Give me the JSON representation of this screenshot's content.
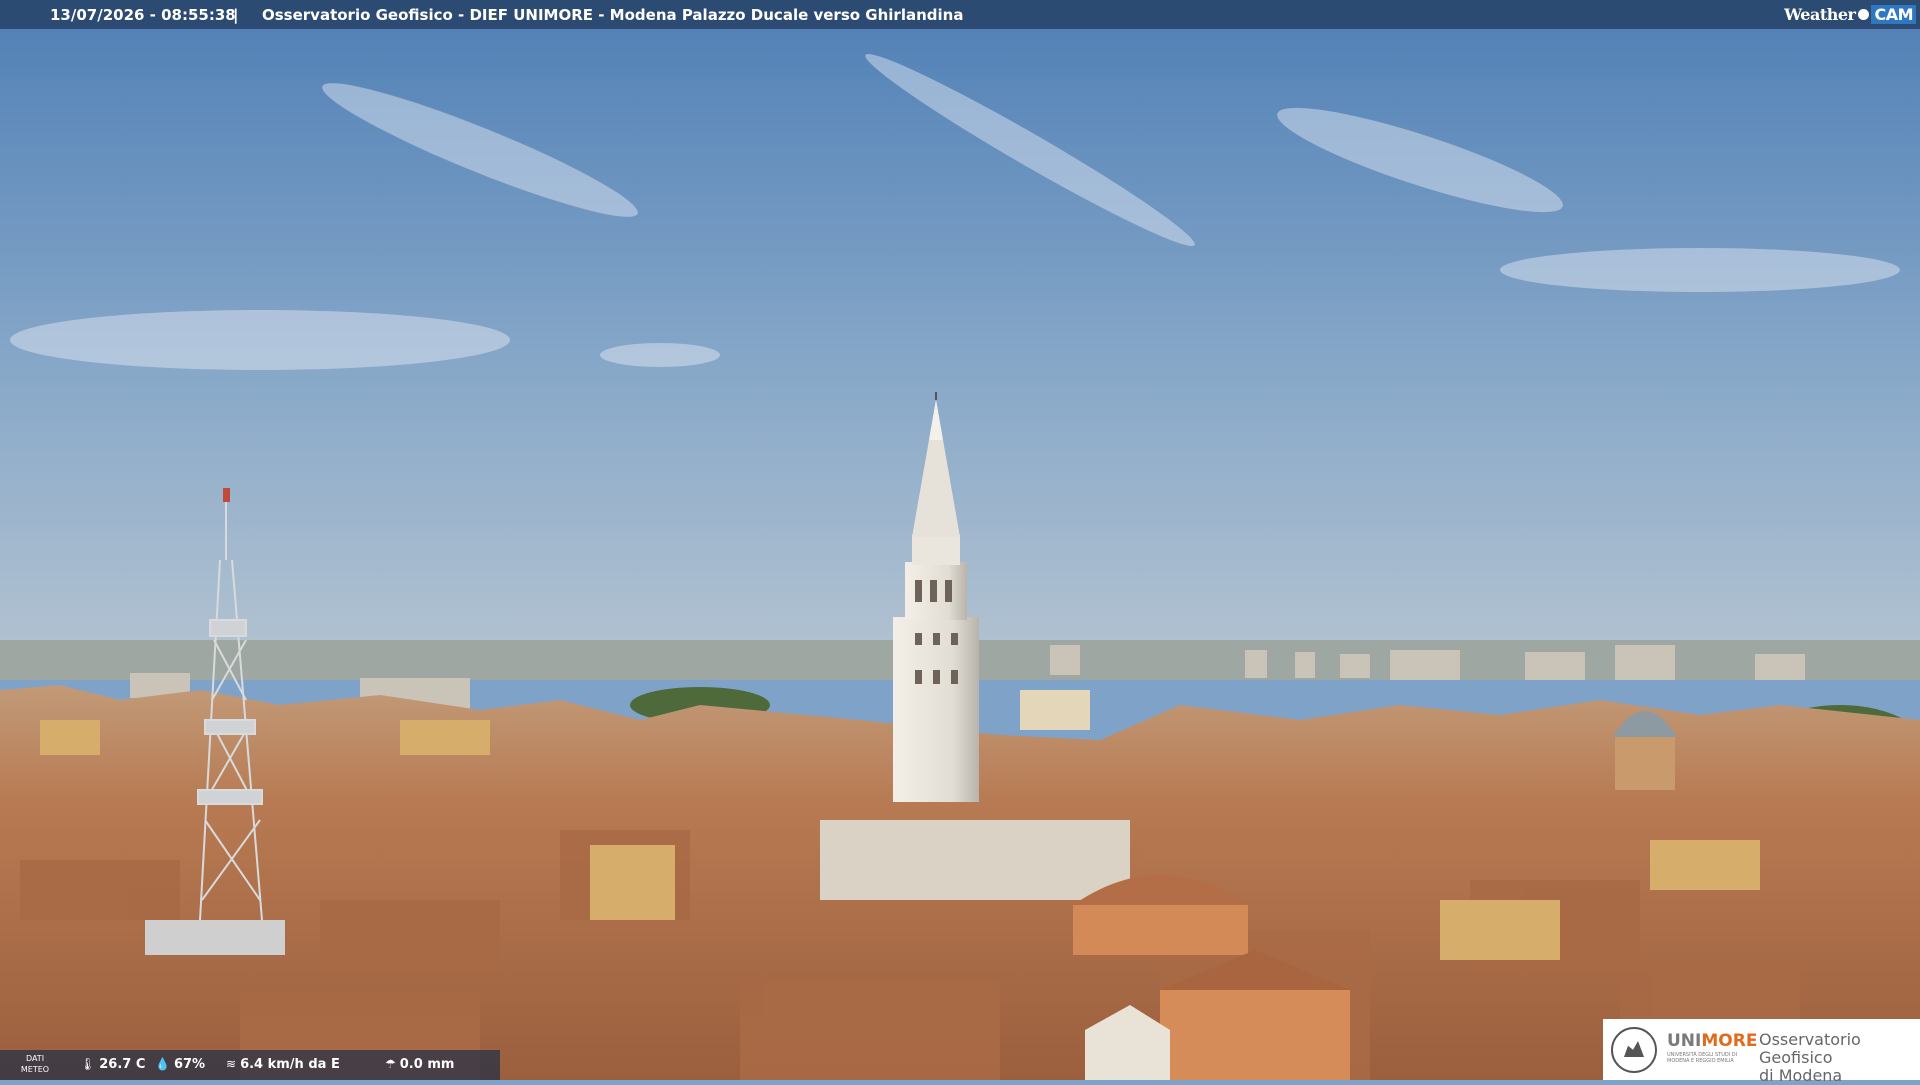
{
  "topbar": {
    "timestamp": "13/07/2026 - 08:55:38",
    "separator": "|",
    "title": "Osservatorio Geofisico - DIEF UNIMORE - Modena Palazzo Ducale verso Ghirlandina",
    "logo_weather": "Weather",
    "logo_cam": "CAM"
  },
  "weather": {
    "label_line1": "DATI",
    "label_line2": "METEO",
    "temperature": "26.7 C",
    "humidity": "67%",
    "wind": "6.4 km/h da E",
    "rain": "0.0 mm",
    "icons": [
      "thermometer-icon",
      "humidity-drop-icon",
      "wind-icon",
      "rain-gauge-icon"
    ]
  },
  "brand": {
    "uni": "UNI",
    "more": "MORE",
    "uni_sub": "UNIVERSITÀ DEGLI STUDI DI MODENA E REGGIO EMILIA",
    "line1": "Osservatorio Geofisico",
    "line2": "di Modena"
  },
  "colors": {
    "sky_top": "#4f7fb6",
    "sky_horizon": "#a9bdd0",
    "roofs": "#b9784f",
    "tower": "#e9e4dc",
    "accent_orange": "#e06b1e"
  }
}
